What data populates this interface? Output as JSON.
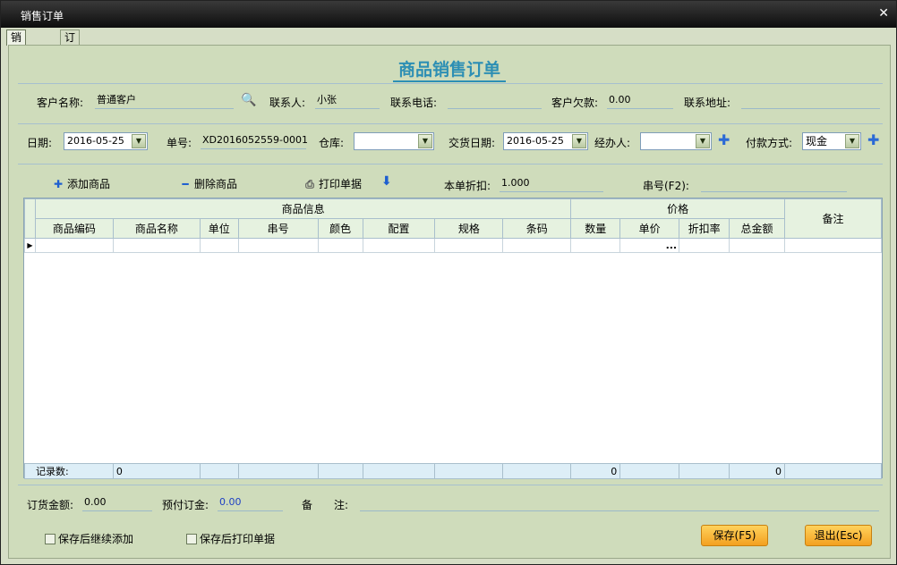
{
  "window": {
    "title": "销售订单",
    "close_glyph": "✕"
  },
  "tabs": [
    {
      "label": "销售订单"
    },
    {
      "label": "订单查询"
    }
  ],
  "heading": "商品销售订单",
  "row1": {
    "customer_label": "客户名称:",
    "customer_value": "普通客户",
    "contact_label": "联系人:",
    "contact_value": "小张",
    "phone_label": "联系电话:",
    "phone_value": "",
    "debt_label": "客户欠款:",
    "debt_value": "0.00",
    "address_label": "联系地址:",
    "address_value": ""
  },
  "row2": {
    "date_label": "日期:",
    "date_value": "2016-05-25",
    "order_no_label": "单号:",
    "order_no_value": "XD2016052559-0001",
    "warehouse_label": "仓库:",
    "warehouse_value": "",
    "delivery_label": "交货日期:",
    "delivery_value": "2016-05-25",
    "handler_label": "经办人:",
    "handler_value": "",
    "payment_label": "付款方式:",
    "payment_value": "现金"
  },
  "toolbar": {
    "add_label": "添加商品",
    "delete_label": "删除商品",
    "print_label": "打印单据",
    "discount_label": "本单折扣:",
    "discount_value": "1.000",
    "serial_label": "串号(F2):",
    "serial_value": ""
  },
  "grid": {
    "group_goods": "商品信息",
    "group_price": "价格",
    "remark": "备注",
    "columns": [
      "商品编码",
      "商品名称",
      "单位",
      "串号",
      "颜色",
      "配置",
      "规格",
      "条码",
      "数量",
      "单价",
      "折扣率",
      "总金额"
    ],
    "edit_button": "...",
    "footer": {
      "label": "记录数:",
      "count": "0",
      "qty_total": "0",
      "amount_total": "0"
    }
  },
  "bottom": {
    "order_amount_label": "订货金额:",
    "order_amount_value": "0.00",
    "prepay_label": "预付订金:",
    "prepay_value": "0.00",
    "remark_label": "备　　注:",
    "remark_value": "",
    "chk_continue": "保存后继续添加",
    "chk_print": "保存后打印单据",
    "save_button": "保存(F5)",
    "exit_button": "退出(Esc)"
  },
  "colors": {
    "accent": "#2d8fb4",
    "panel": "#cfdcbb",
    "button": "#f3a020"
  },
  "icons": [
    "binoculars-icon",
    "plus-icon",
    "minus-icon",
    "printer-icon",
    "arrow-down-icon",
    "row-pointer-icon",
    "dropdown-arrow-icon"
  ]
}
